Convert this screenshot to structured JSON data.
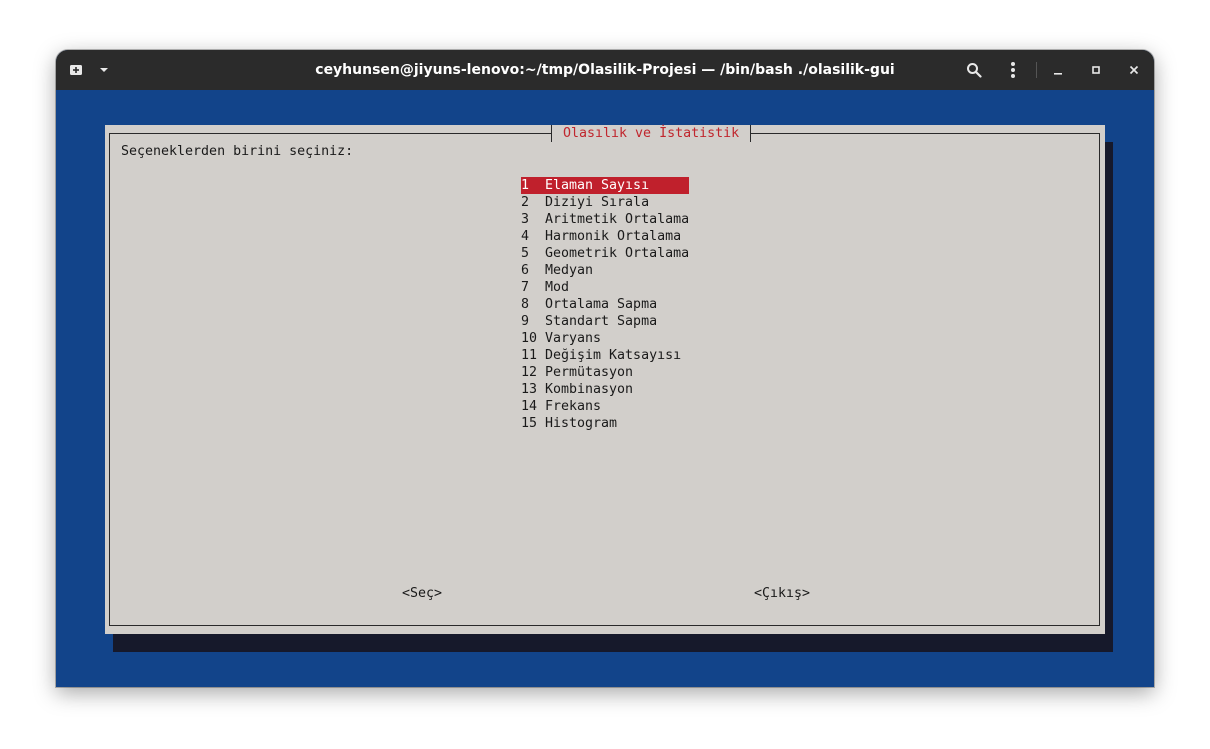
{
  "window": {
    "title": "ceyhunsen@jiyuns-lenovo:~/tmp/Olasilik-Projesi — /bin/bash ./olasilik-gui"
  },
  "dialog": {
    "title": "Olasılık ve İstatistik",
    "prompt": "Seçeneklerden birini seçiniz:",
    "selected_index": 0,
    "items": [
      {
        "num": "1",
        "label": "Elaman Sayısı"
      },
      {
        "num": "2",
        "label": "Diziyi Sırala"
      },
      {
        "num": "3",
        "label": "Aritmetik Ortalama"
      },
      {
        "num": "4",
        "label": "Harmonik Ortalama"
      },
      {
        "num": "5",
        "label": "Geometrik Ortalama"
      },
      {
        "num": "6",
        "label": "Medyan"
      },
      {
        "num": "7",
        "label": "Mod"
      },
      {
        "num": "8",
        "label": "Ortalama Sapma"
      },
      {
        "num": "9",
        "label": "Standart Sapma"
      },
      {
        "num": "10",
        "label": "Varyans"
      },
      {
        "num": "11",
        "label": "Değişim Katsayısı"
      },
      {
        "num": "12",
        "label": "Permütasyon"
      },
      {
        "num": "13",
        "label": "Kombinasyon"
      },
      {
        "num": "14",
        "label": "Frekans"
      },
      {
        "num": "15",
        "label": "Histogram"
      }
    ],
    "ok_label": "<Seç>",
    "cancel_label": "<Çıkış>"
  },
  "colors": {
    "terminal_bg": "#12448a",
    "dialog_bg": "#d2cfcb",
    "accent_red": "#c0202c",
    "titlebar_bg": "#2b2b2b"
  }
}
